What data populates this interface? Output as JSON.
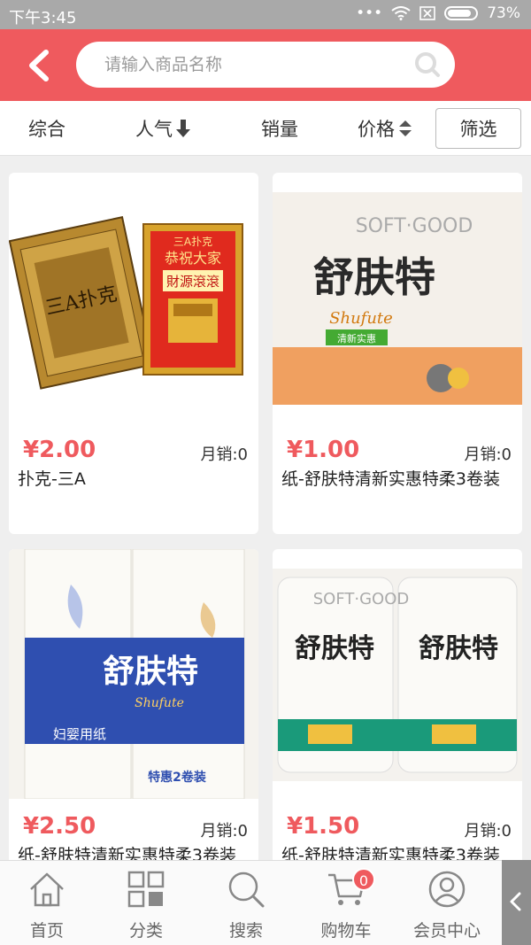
{
  "status": {
    "time": "下午3:45",
    "battery": "73%"
  },
  "header": {
    "search_placeholder": "请输入商品名称"
  },
  "sort": {
    "items": [
      {
        "label": "综合"
      },
      {
        "label": "人气"
      },
      {
        "label": "销量"
      },
      {
        "label": "价格"
      }
    ],
    "filter_label": "筛选"
  },
  "products": [
    {
      "price": "¥2.00",
      "sales_label": "月销:",
      "sales": "0",
      "title": "扑克-三A"
    },
    {
      "price": "¥1.00",
      "sales_label": "月销:",
      "sales": "0",
      "title": "纸-舒肤特清新实惠特柔3卷装"
    },
    {
      "price": "¥2.50",
      "sales_label": "月销:",
      "sales": "0",
      "title": "纸-舒肤特清新实惠特柔3卷装"
    },
    {
      "price": "¥1.50",
      "sales_label": "月销:",
      "sales": "0",
      "title": "纸-舒肤特清新实惠特柔3卷装"
    }
  ],
  "image_text": {
    "p1_left": "三A扑克",
    "p1_right_top": "三A扑克",
    "p1_right_mid": "恭祝大家",
    "p1_right_box": "財源滾滾",
    "brand": "舒肤特",
    "brand_en": "Shufute",
    "soft_good": "SOFT·GOOD",
    "fresh": "清新实惠",
    "p3_sub": "妇婴用纸",
    "p3_promo": "特惠2卷装"
  },
  "tabbar": {
    "items": [
      {
        "label": "首页",
        "icon": "home-icon"
      },
      {
        "label": "分类",
        "icon": "grid-icon"
      },
      {
        "label": "搜索",
        "icon": "search-icon"
      },
      {
        "label": "购物车",
        "icon": "cart-icon"
      },
      {
        "label": "会员中心",
        "icon": "user-icon"
      }
    ],
    "cart_count": "0"
  },
  "colors": {
    "accent": "#ef5a5e",
    "statusbar": "#a9a9a9"
  }
}
